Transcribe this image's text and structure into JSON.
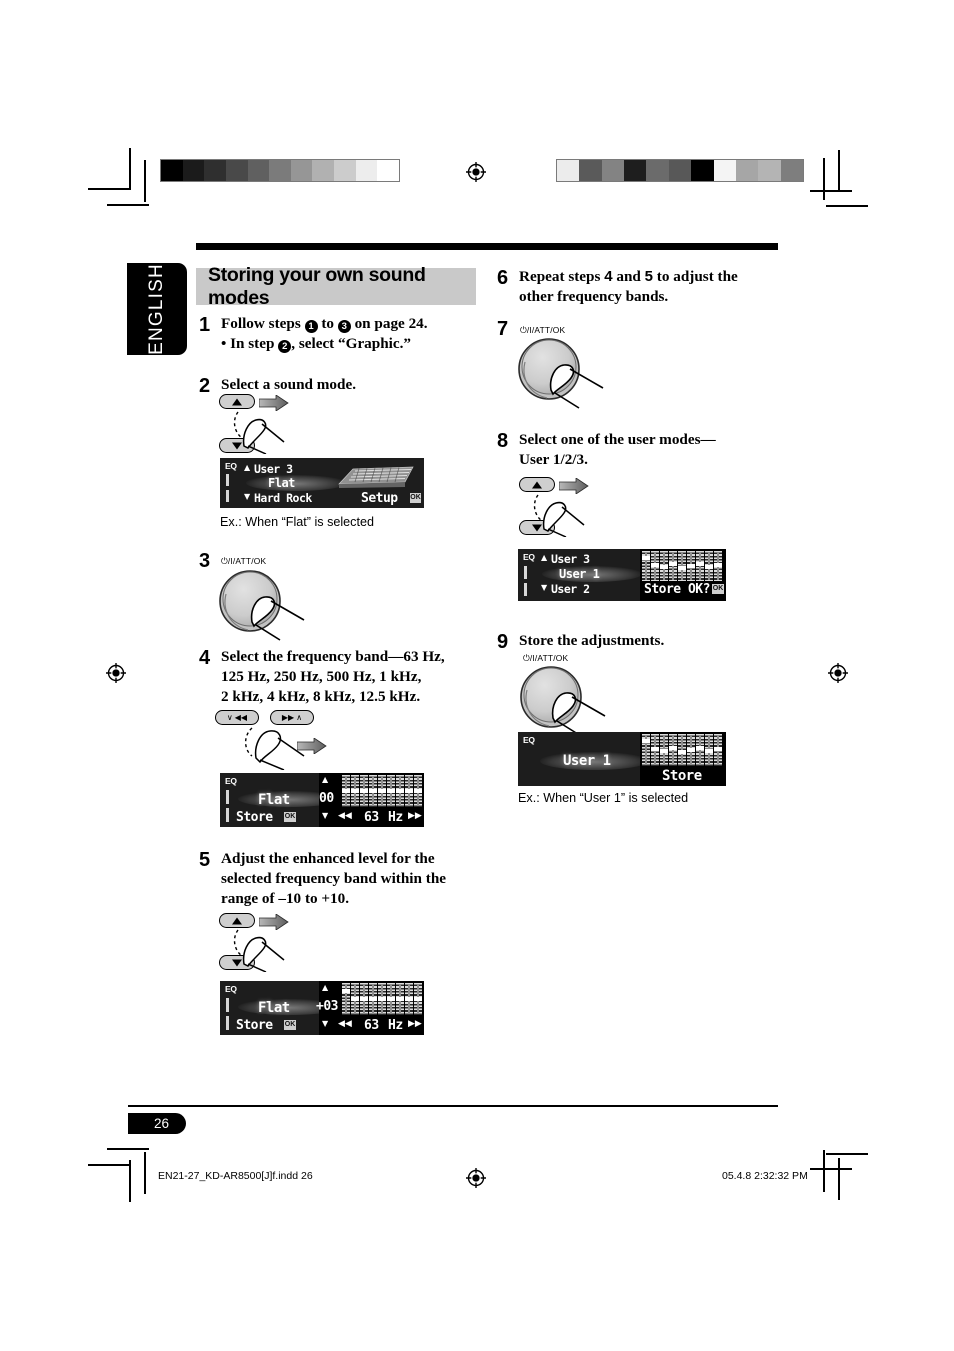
{
  "language_tab": "ENGLISH",
  "heading": "Storing your own sound modes",
  "steps": {
    "s1": {
      "num": "1",
      "line1_a": "Follow steps ",
      "line1_c1": "1",
      "line1_b": " to ",
      "line1_c2": "3",
      "line1_c": " on page 24.",
      "line2_a": "• In step ",
      "line2_c": "2",
      "line2_b": ", select “Graphic.”"
    },
    "s2": {
      "num": "2",
      "text": "Select a sound mode.",
      "caption": "Ex.:  When “Flat” is selected"
    },
    "s3": {
      "num": "3",
      "knob_label": "⏻/I/ATT/OK"
    },
    "s4": {
      "num": "4",
      "line1": "Select the frequency band—63 Hz,",
      "line2": "125 Hz, 250 Hz, 500 Hz, 1 kHz,",
      "line3": "2 kHz, 4 kHz, 8 kHz, 12.5 kHz."
    },
    "s5": {
      "num": "5",
      "line1": "Adjust the enhanced level for the",
      "line2": "selected frequency band within the",
      "line3": "range of –10 to +10."
    },
    "s6": {
      "num": "6",
      "line1_a": "Repeat steps ",
      "line1_n1": "4",
      "line1_b": " and ",
      "line1_n2": "5",
      "line1_c": " to adjust the",
      "line2": "other frequency bands."
    },
    "s7": {
      "num": "7",
      "knob_label": "⏻/I/ATT/OK"
    },
    "s8": {
      "num": "8",
      "line1": "Select one of the user modes—",
      "line2": "User 1/2/3."
    },
    "s9": {
      "num": "9",
      "text": "Store the adjustments.",
      "knob_label": "⏻/I/ATT/OK",
      "caption": "Ex.:  When “User 1” is selected"
    }
  },
  "displays": {
    "d2": {
      "eq": "EQ",
      "row_up": "User 3",
      "row_sel": "Flat",
      "row_dn": "Hard Rock",
      "right_label": "Setup",
      "ok": "OK"
    },
    "d4": {
      "eq": "EQ",
      "row_sel": "Flat",
      "store": "Store",
      "ok": "OK",
      "level": "00",
      "freq_value": "63",
      "freq_unit": "Hz"
    },
    "d5": {
      "eq": "EQ",
      "row_sel": "Flat",
      "store": "Store",
      "ok": "OK",
      "level": "+03",
      "freq_value": "63",
      "freq_unit": "Hz"
    },
    "d8": {
      "eq": "EQ",
      "row_up": "User 3",
      "row_sel": "User 1",
      "row_dn": "User 2",
      "store_prompt": "Store OK?",
      "ok": "OK"
    },
    "d9": {
      "eq": "EQ",
      "row_sel": "User 1",
      "store": "Store"
    }
  },
  "eq_bars": {
    "count": 9,
    "flat_positions": [
      50,
      50,
      50,
      50,
      50,
      50,
      50,
      50,
      50
    ],
    "adjusted_positions": [
      22,
      50,
      50,
      50,
      50,
      50,
      50,
      50,
      50
    ],
    "user1_positions": [
      18,
      46,
      52,
      44,
      56,
      50,
      44,
      52,
      46
    ]
  },
  "footer": {
    "page_number": "26",
    "file_name": "EN21-27_KD-AR8500[J]f.indd   26",
    "timestamp": "05.4.8   2:32:32 PM"
  },
  "calibration": {
    "left_strip": [
      "#000000",
      "#1b1b1b",
      "#2f2f2f",
      "#494949",
      "#606060",
      "#7b7b7b",
      "#969696",
      "#b1b1b1",
      "#cccccc",
      "#ededed",
      "#ffffff"
    ],
    "right_strip": [
      "#ececec",
      "#5a5a5a",
      "#838383",
      "#1e1e1e",
      "#6b6b6b",
      "#585858",
      "#000000",
      "#f4f4f4",
      "#a6a6a6",
      "#b4b4b4",
      "#7e7e7e"
    ]
  }
}
